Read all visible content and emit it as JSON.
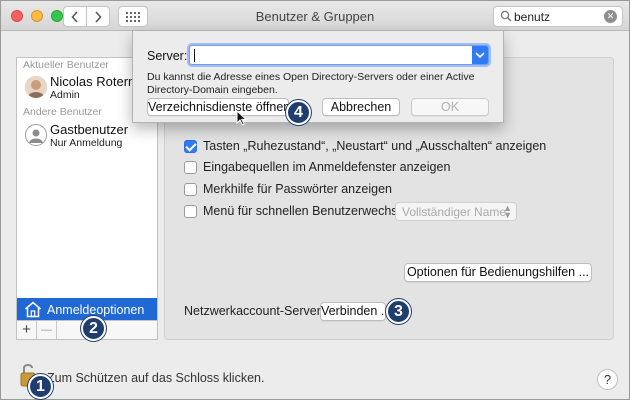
{
  "window": {
    "title": "Benutzer & Gruppen",
    "search_value": "benutz"
  },
  "sidebar": {
    "current_user_header": "Aktueller Benutzer",
    "current_user": {
      "name": "Nicolas Rotermu",
      "role": "Admin"
    },
    "other_users_header": "Andere Benutzer",
    "other_users": [
      {
        "name": "Gastbenutzer",
        "role": "Nur Anmeldung"
      }
    ],
    "selected_item": "Anmeldeoptionen",
    "add_label": "+",
    "remove_label": "—"
  },
  "options": {
    "checkboxes": [
      {
        "label": "Tasten „Ruhezustand“, „Neustart“ und „Ausschalten“ anzeigen",
        "checked": true
      },
      {
        "label": "Eingabequellen im Anmeldefenster anzeigen",
        "checked": false
      },
      {
        "label": "Merkhilfe für Passwörter anzeigen",
        "checked": false
      },
      {
        "label": "Menü für schnellen Benutzerwechsel",
        "checked": false
      }
    ],
    "fast_user_switch_select": "Vollständiger Name",
    "accessibility_button": "Optionen für Bedienungshilfen ...",
    "network_server_label": "Netzwerkaccount-Server:",
    "connect_button": "Verbinden ..."
  },
  "lock": {
    "text": "Zum Schützen auf das Schloss klicken."
  },
  "help_label": "?",
  "dialog": {
    "server_label": "Server:",
    "server_value": "",
    "description": "Du kannst die Adresse eines Open Directory-Servers oder einer Active Directory-Domain eingeben.",
    "open_directory_button": "Verzeichnisdienste öffnen",
    "cancel_button": "Abbrechen",
    "ok_button": "OK"
  },
  "markers": [
    "1",
    "2",
    "3",
    "4"
  ],
  "colors": {
    "accent": "#1f68d6",
    "marker": "#1f3d6e"
  }
}
